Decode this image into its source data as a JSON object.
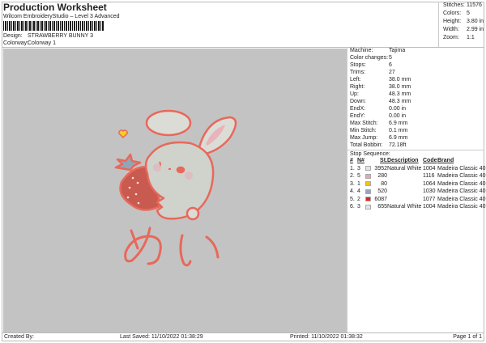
{
  "header": {
    "title": "Production Worksheet",
    "subtitle": "Wilcom EmbroideryStudio – Level 3 Advanced",
    "design_label": "Design:",
    "design": "STRAWBERRY BUNNY 3",
    "colorway_label": "Colorway:",
    "colorway": "Colorway 1"
  },
  "stats": [
    {
      "label": "Stitches:",
      "value": "11576"
    },
    {
      "label": "Colors:",
      "value": "5"
    },
    {
      "label": "Height:",
      "value": "3.80 in"
    },
    {
      "label": "Width:",
      "value": "2.99 in"
    },
    {
      "label": "Zoom:",
      "value": "1:1"
    }
  ],
  "info": [
    {
      "label": "Machine:",
      "value": "Tajima"
    },
    {
      "label": "Color changes:",
      "value": "5"
    },
    {
      "label": "Stops:",
      "value": "6"
    },
    {
      "label": "Trims:",
      "value": "27"
    },
    {
      "label": "Left:",
      "value": "38.0 mm"
    },
    {
      "label": "Right:",
      "value": "38.0 mm"
    },
    {
      "label": "Up:",
      "value": "48.3 mm"
    },
    {
      "label": "Down:",
      "value": "48.3 mm"
    },
    {
      "label": "EndX:",
      "value": "0.00 in"
    },
    {
      "label": "EndY:",
      "value": "0.00 in"
    },
    {
      "label": "Max Stitch:",
      "value": "6.9 mm"
    },
    {
      "label": "Min Stitch:",
      "value": "0.1 mm"
    },
    {
      "label": "Max Jump:",
      "value": "6.9 mm"
    },
    {
      "label": "Total Bobbin:",
      "value": "72.18ft"
    }
  ],
  "stop_sequence": {
    "title": "Stop Sequence:",
    "headers": [
      "#",
      "N#",
      "St.",
      "Description",
      "Code",
      "Brand"
    ],
    "rows": [
      {
        "n": "1.",
        "needle": "3",
        "color": "#e4e4e4",
        "st": "3952",
        "desc": "Natural White",
        "code": "1004",
        "brand": "Madeira Classic 40"
      },
      {
        "n": "2.",
        "needle": "5",
        "color": "#e8a4b4",
        "st": "280",
        "desc": "",
        "code": "1116",
        "brand": "Madeira Classic 40"
      },
      {
        "n": "3.",
        "needle": "1",
        "color": "#f2c21e",
        "st": "80",
        "desc": "",
        "code": "1064",
        "brand": "Madeira Classic 40"
      },
      {
        "n": "4.",
        "needle": "4",
        "color": "#8fa6c6",
        "st": "520",
        "desc": "",
        "code": "1030",
        "brand": "Madeira Classic 40"
      },
      {
        "n": "5.",
        "needle": "2",
        "color": "#e0261e",
        "st": "6087",
        "desc": "",
        "code": "1077",
        "brand": "Madeira Classic 40"
      },
      {
        "n": "6.",
        "needle": "3",
        "color": "#e4e4e4",
        "st": "655",
        "desc": "Natural White",
        "code": "1004",
        "brand": "Madeira Classic 40"
      }
    ]
  },
  "footer": {
    "created": "Created By:",
    "saved": "Last Saved: 11/10/2022 01:38:29",
    "printed": "Printed: 11/10/2022 01:38:32",
    "page": "Page 1 of 1"
  }
}
